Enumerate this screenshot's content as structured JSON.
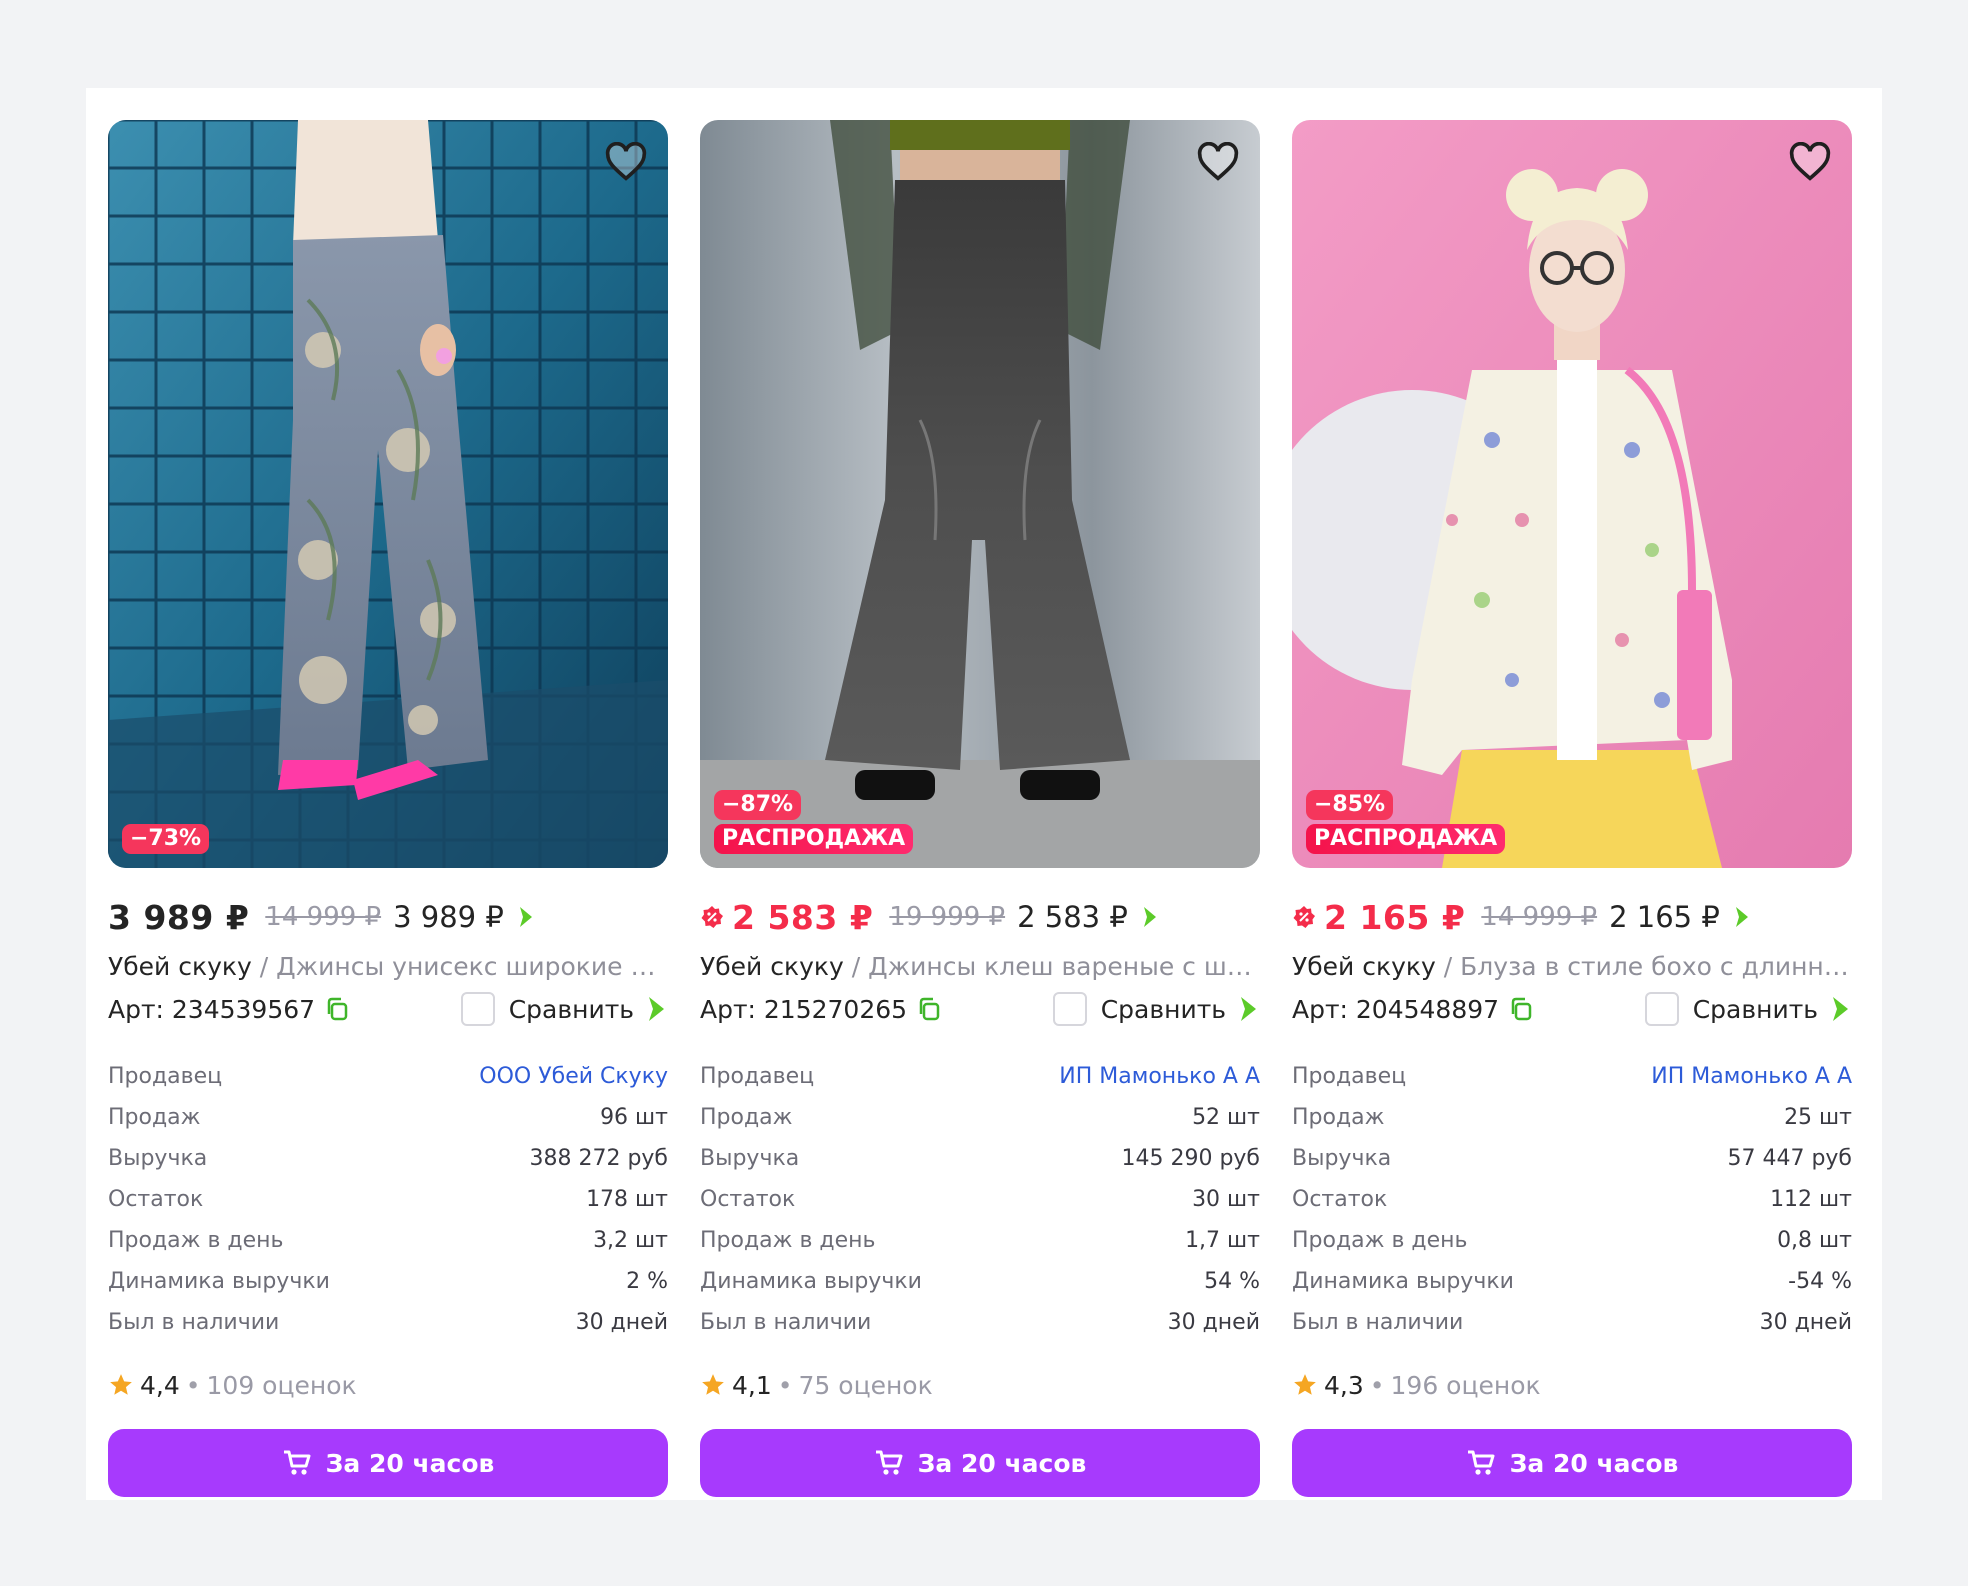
{
  "colors": {
    "accent_button": "#a73afd",
    "price_red": "#f42c4a",
    "badge_red": "#f5365c",
    "link_blue": "#2d5bd8",
    "wallet_green": "#5ccb29",
    "star_orange": "#f5a623"
  },
  "icons": {
    "favorite": "heart-outline-icon",
    "copy": "copy-icon",
    "wallet": "wallet-arrow-icon",
    "cart": "cart-icon",
    "star": "star-icon",
    "sale": "sale-percent-icon"
  },
  "labels": {
    "seller": "Продавец",
    "sales": "Продаж",
    "revenue": "Выручка",
    "stock": "Остаток",
    "sales_per_day": "Продаж в день",
    "revenue_dynamics": "Динамика выручки",
    "in_stock_days": "Был в наличии",
    "compare": "Сравнить",
    "buy_button": "За 20 часов",
    "separator": "/",
    "dot": "•"
  },
  "cards": [
    {
      "badge_discount": "−73%",
      "badge_sale": "",
      "price": "3 989 ₽",
      "price_is_sale": false,
      "old_price": "14 999 ₽",
      "wallet_price": "3 989 ₽",
      "brand": "Убей скуку",
      "name": "Джинсы унисекс широкие …",
      "article": "Арт: 234539567",
      "seller": "ООО Убей Скуку",
      "sales": "96 шт",
      "revenue": "388 272 руб",
      "stock": "178 шт",
      "sales_per_day": "3,2 шт",
      "revenue_dynamics": "2 %",
      "in_stock_days": "30 дней",
      "rating": "4,4",
      "reviews": "109 оценок"
    },
    {
      "badge_discount": "−87%",
      "badge_sale": "РАСПРОДАЖА",
      "price": "2 583 ₽",
      "price_is_sale": true,
      "old_price": "19 999 ₽",
      "wallet_price": "2 583 ₽",
      "brand": "Убей скуку",
      "name": "Джинсы клеш вареные с ш…",
      "article": "Арт: 215270265",
      "seller": "ИП Мамонько А А",
      "sales": "52 шт",
      "revenue": "145 290 руб",
      "stock": "30 шт",
      "sales_per_day": "1,7 шт",
      "revenue_dynamics": "54 %",
      "in_stock_days": "30 дней",
      "rating": "4,1",
      "reviews": "75 оценок"
    },
    {
      "badge_discount": "−85%",
      "badge_sale": "РАСПРОДАЖА",
      "price": "2 165 ₽",
      "price_is_sale": true,
      "old_price": "14 999 ₽",
      "wallet_price": "2 165 ₽",
      "brand": "Убей скуку",
      "name": "Блуза в стиле бохо с длинн…",
      "article": "Арт: 204548897",
      "seller": "ИП Мамонько А А",
      "sales": "25 шт",
      "revenue": "57 447 руб",
      "stock": "112 шт",
      "sales_per_day": "0,8 шт",
      "revenue_dynamics": "-54 %",
      "in_stock_days": "30 дней",
      "rating": "4,3",
      "reviews": "196 оценок"
    }
  ]
}
